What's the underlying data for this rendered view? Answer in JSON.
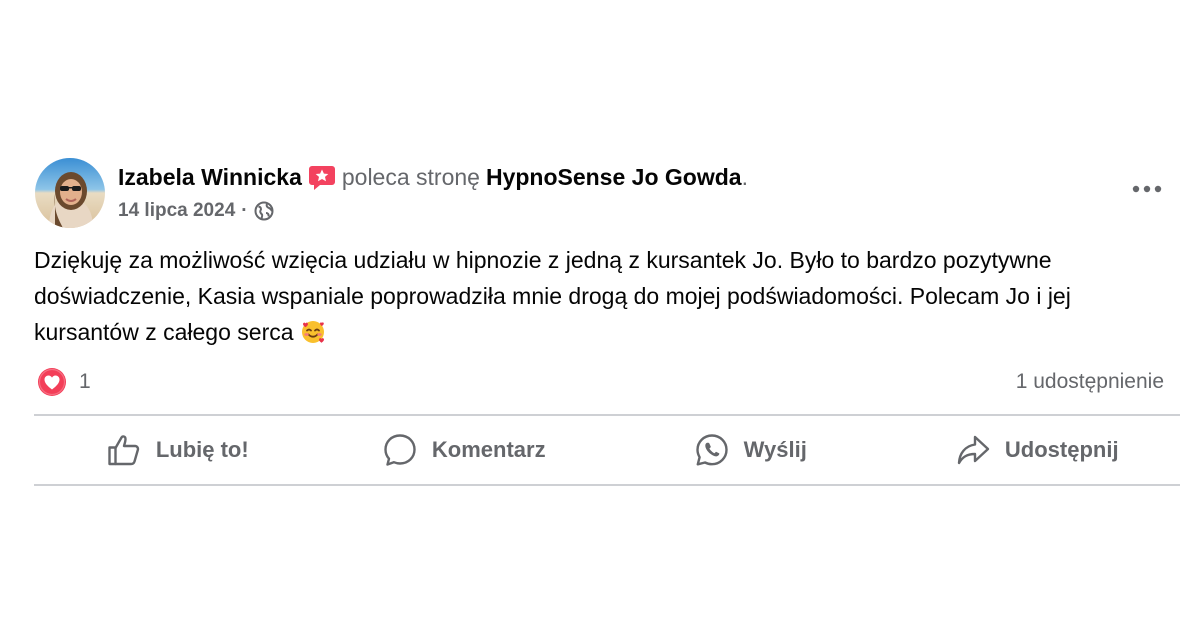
{
  "post": {
    "author": "Izabela Winnicka",
    "recommend_text": "poleca stronę",
    "page_name": "HypnoSense Jo Gowda",
    "period": ".",
    "date": "14 lipca 2024",
    "separator": "·",
    "privacy_icon": "globe-icon",
    "more_icon": "more-options-icon",
    "body": "Dziękuję za możliwość wzięcia udziału w hipnozie z jedną z kursantek Jo. Było to bardzo pozytywne doświadczenie, Kasia wspaniale poprowadziła mnie drogą do mojej podświadomości. Polecam Jo i jej kursantów z całego serca",
    "body_emoji": "smiling-face-with-hearts-emoji"
  },
  "stats": {
    "reaction_icon": "love-reaction-icon",
    "reaction_count": "1",
    "shares": "1 udostępnienie"
  },
  "actions": {
    "like": "Lubię to!",
    "comment": "Komentarz",
    "send": "Wyślij",
    "share": "Udostępnij"
  },
  "colors": {
    "primary_text": "#050505",
    "secondary_text": "#65676b",
    "divider": "#ced0d4",
    "love_red": "#f33e58",
    "recommend_badge": "#f3425f"
  }
}
